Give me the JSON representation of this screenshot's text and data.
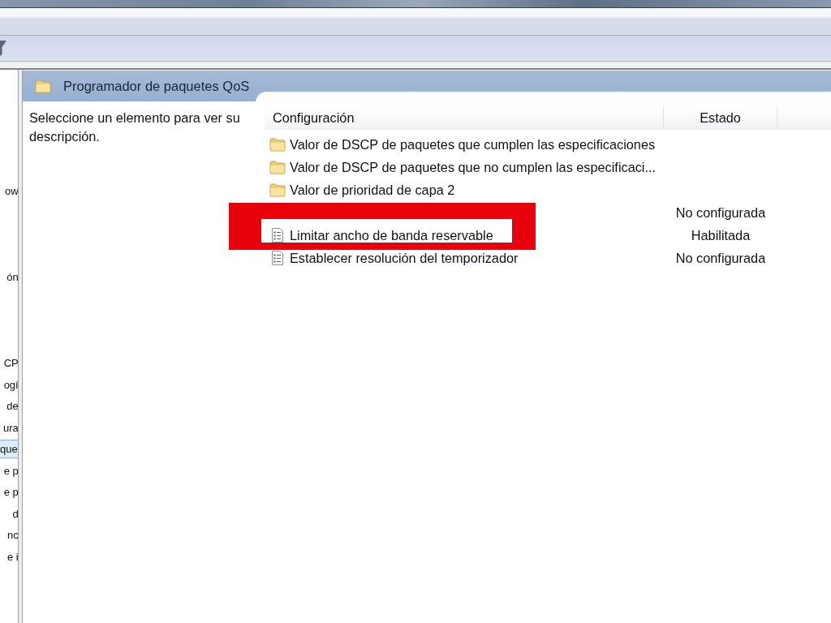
{
  "tree": {
    "items": [
      {
        "label": "ow",
        "selected": false
      },
      {
        "label": "ón",
        "selected": false
      },
      {
        "label": "CP",
        "selected": false
      },
      {
        "label": "ogí",
        "selected": false
      },
      {
        "label": "de",
        "selected": false
      },
      {
        "label": "ura",
        "selected": false
      },
      {
        "label": "que",
        "selected": true
      },
      {
        "label": "e p",
        "selected": false
      },
      {
        "label": "e p",
        "selected": false
      },
      {
        "label": "d",
        "selected": false
      },
      {
        "label": "nc",
        "selected": false
      },
      {
        "label": "e i",
        "selected": false
      }
    ]
  },
  "details": {
    "title": "Programador de paquetes QoS",
    "description": "Seleccione un elemento para ver su descripción."
  },
  "table": {
    "columns": [
      "Configuración",
      "Estado"
    ],
    "rows": [
      {
        "kind": "folder",
        "name": "Valor de DSCP de paquetes que cumplen las especificaciones",
        "highlighted": false
      },
      {
        "kind": "folder",
        "name": "Valor de DSCP de paquetes que no cumplen las especificaci...",
        "highlighted": false
      },
      {
        "kind": "folder",
        "name": "Valor de prioridad de capa 2",
        "highlighted": false
      },
      {
        "state": "No configurada",
        "highlighted": false
      },
      {
        "kind": "setting",
        "name": "Limitar ancho de banda reservable",
        "state": "Habilitada",
        "highlighted": true
      },
      {
        "kind": "setting",
        "name": "Establecer resolución del temporizador",
        "state": "No configurada",
        "highlighted": false
      }
    ]
  }
}
